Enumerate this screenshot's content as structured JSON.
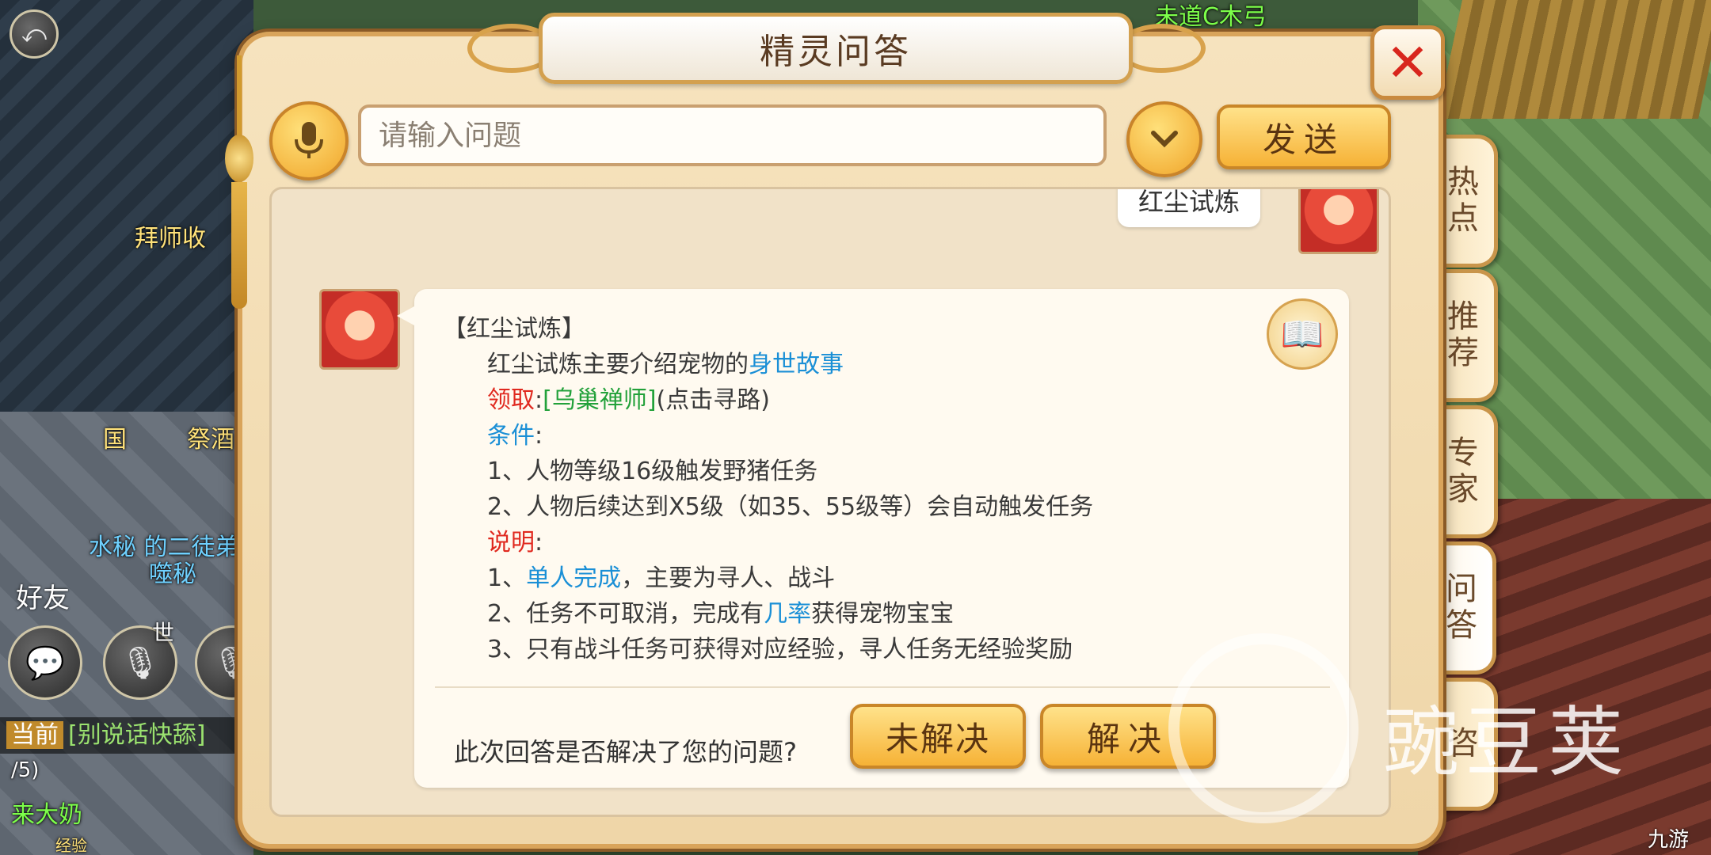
{
  "background": {
    "tags": [
      "拜师收",
      "国",
      "祭酒",
      "水秘 的二徒弟",
      "噬秘",
      "来大奶",
      "经验",
      "未道C木弓",
      "世"
    ],
    "left_buttons": {
      "friend_label": "好友",
      "world_label": "世"
    },
    "chat_bar": {
      "channel": "当前",
      "text": "[别说话快舔]",
      "line2": "/5)"
    }
  },
  "dialog": {
    "title": "精灵问答",
    "close_icon": "close-icon"
  },
  "input_row": {
    "placeholder": "请输入问题",
    "send_label": "发送"
  },
  "side_tabs": [
    "热点",
    "推荐",
    "专家",
    "问答",
    "咨"
  ],
  "chat": {
    "user_question": "红尘试炼",
    "answer": {
      "heading": "【红尘试炼】",
      "intro": "红尘试炼主要介绍宠物的",
      "intro_link": "身世故事",
      "receive_label": "领取",
      "receive_sep": ":",
      "receive_npc": "[乌巢禅师]",
      "receive_hint": "(点击寻路)",
      "condition_label": "条件",
      "condition_sep": ":",
      "conditions": [
        "1、人物等级16级触发野猪任务",
        "2、人物后续达到X5级（如35、55级等）会自动触发任务"
      ],
      "note_label": "说明",
      "note_sep": ":",
      "note1_prefix": "1、",
      "note1_link": "单人完成",
      "note1_rest": "，主要为寻人、战斗",
      "note2_prefix": "2、任务不可取消，完成有",
      "note2_link": "几率",
      "note2_rest": "获得宠物宝宝",
      "note3": "3、只有战斗任务可获得对应经验，寻人任务无经验奖励"
    },
    "feedback_question": "此次回答是否解决了您的问题?",
    "unresolved_label": "未解决",
    "resolved_label": "解决"
  },
  "watermark": {
    "text": "豌豆荚",
    "corner": "九游"
  }
}
